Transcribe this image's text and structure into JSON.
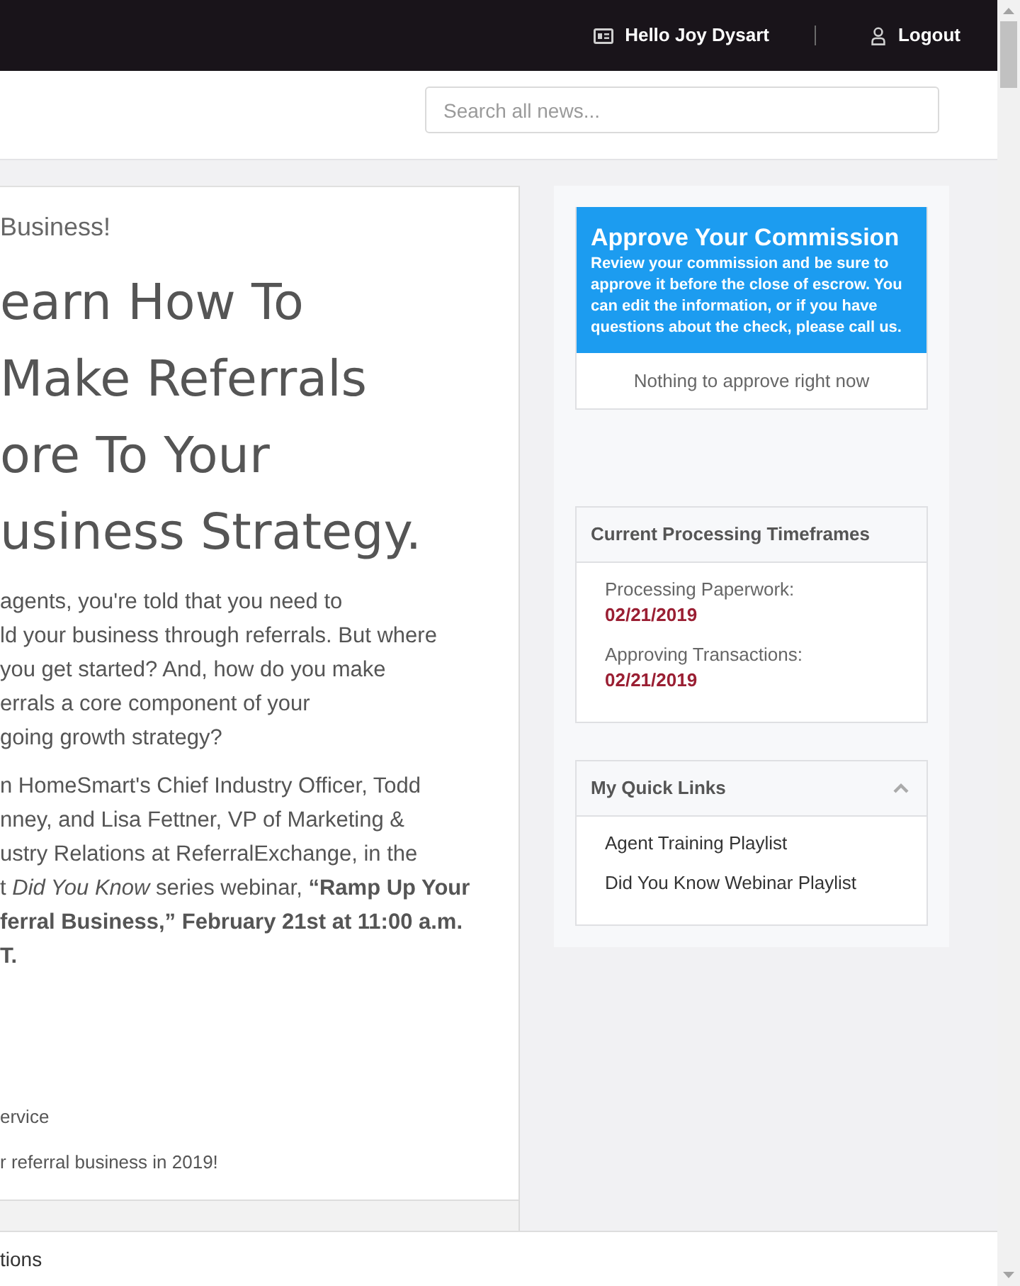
{
  "top_bar": {
    "greeting": "Hello Joy Dysart",
    "logout": "Logout"
  },
  "search": {
    "placeholder": "Search all news..."
  },
  "article": {
    "intro": "Business!",
    "heading_lines": [
      "earn How To",
      "Make Referrals",
      "ore To Your",
      "usiness Strategy."
    ],
    "paragraphs": [
      [
        {
          "text": "agents, you're told that you  need to",
          "bold": false
        },
        {
          "text": "ld your business through referrals. But where",
          "bold": false
        },
        {
          "text": "you get started? And, how do you make",
          "bold": false
        },
        {
          "text": "errals a core component of your",
          "bold": false
        },
        {
          "text": "going growth strategy?",
          "bold": false
        }
      ],
      [
        {
          "text": "n HomeSmart's Chief Industry Officer, Todd",
          "bold": false
        },
        {
          "text": "nney, and Lisa Fettner, VP of Marketing &",
          "bold": false
        },
        {
          "text": "ustry Relations at ReferralExchange, in the",
          "bold": false
        },
        {
          "text": "t *Did You Know* series webinar, **“Ramp Up Your**",
          "bold": false
        },
        {
          "text": "ferral Business,” February 21st at 11:00 a.m.",
          "bold": true
        },
        {
          "text": "T.",
          "bold": true
        }
      ]
    ],
    "footer_lines": [
      "ervice",
      "r referral business in 2019!"
    ]
  },
  "sidebar": {
    "commission": {
      "title": "Approve Your Commission",
      "description": "Review your commission and be sure to approve it before the close of escrow. You can edit the information, or if you have questions about the check, please call us.",
      "empty_message": "Nothing to approve right now"
    },
    "timeframes": {
      "title": "Current Processing Timeframes",
      "items": [
        {
          "label": "Processing Paperwork:",
          "date": "02/21/2019"
        },
        {
          "label": "Approving Transactions:",
          "date": "02/21/2019"
        }
      ]
    },
    "quick_links": {
      "title": "My Quick Links",
      "expanded": true,
      "links": [
        "Agent Training Playlist",
        "Did You Know Webinar Playlist"
      ]
    }
  },
  "bottom_bar": {
    "text": "tions"
  }
}
